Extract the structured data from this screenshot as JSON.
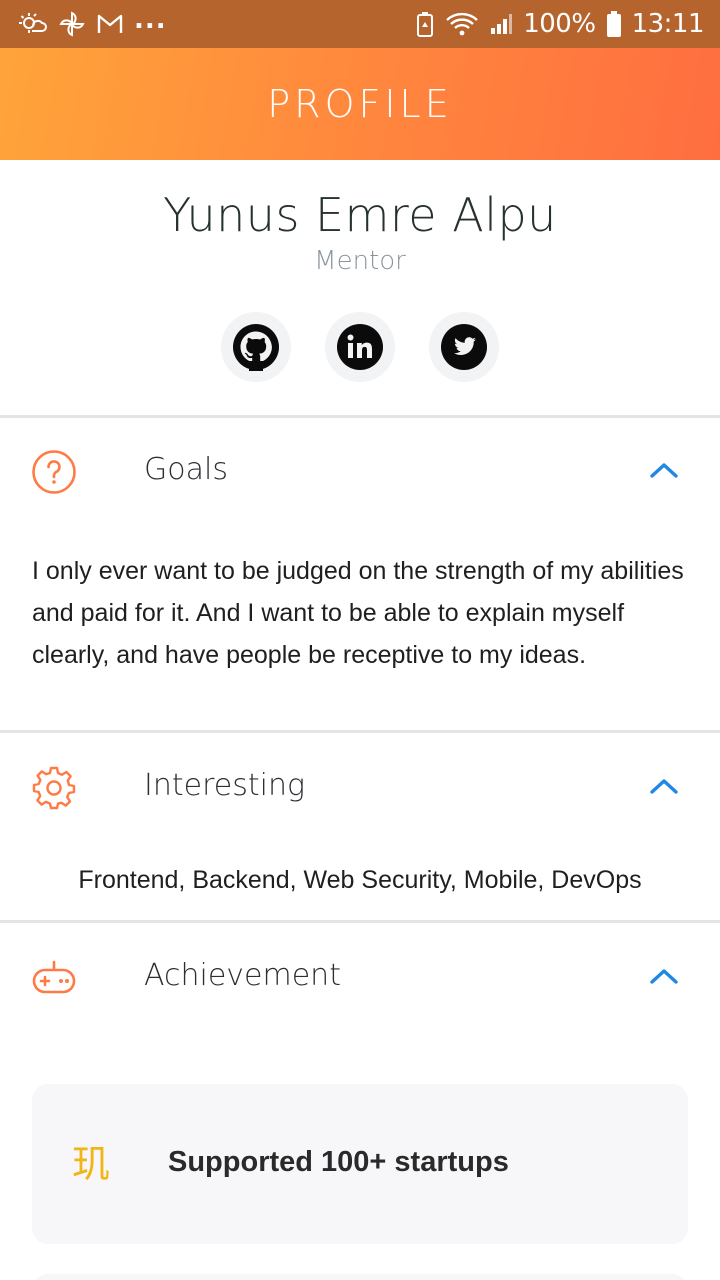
{
  "status_bar": {
    "battery_percent": "100%",
    "time": "13:11",
    "more_indicator": "...",
    "left_icons": [
      "weather-icon",
      "pinwheel-icon",
      "gmail-icon"
    ],
    "right_icons": [
      "battery-saver-icon",
      "wifi-icon",
      "signal-icon",
      "battery-icon"
    ]
  },
  "header": {
    "title": "PROFILE"
  },
  "profile": {
    "name": "Yunus Emre Alpu",
    "role": "Mentor",
    "socials": [
      "github-icon",
      "linkedin-icon",
      "twitter-icon"
    ]
  },
  "sections": {
    "goals": {
      "title": "Goals",
      "icon": "question-icon",
      "text": "I only ever want to be judged on the strength of my abilities and paid for it. And I want to be able to explain myself clearly, and have people be receptive to my ideas."
    },
    "interesting": {
      "title": "Interesting",
      "icon": "gear-icon",
      "text": "Frontend, Backend, Web Security, Mobile, DevOps"
    },
    "achievement": {
      "title": "Achievement",
      "icon": "gamepad-icon",
      "items": [
        {
          "icon": "achievement-glyph-icon",
          "glyph": "玑",
          "label": "Supported 100+ startups"
        }
      ]
    }
  },
  "colors": {
    "accent_orange": "#ff7a45",
    "chevron_blue": "#1e88e5",
    "header_gradient_start": "#ffa43a",
    "header_gradient_end": "#ff6e40",
    "achievement_icon_yellow": "#f3b516"
  }
}
